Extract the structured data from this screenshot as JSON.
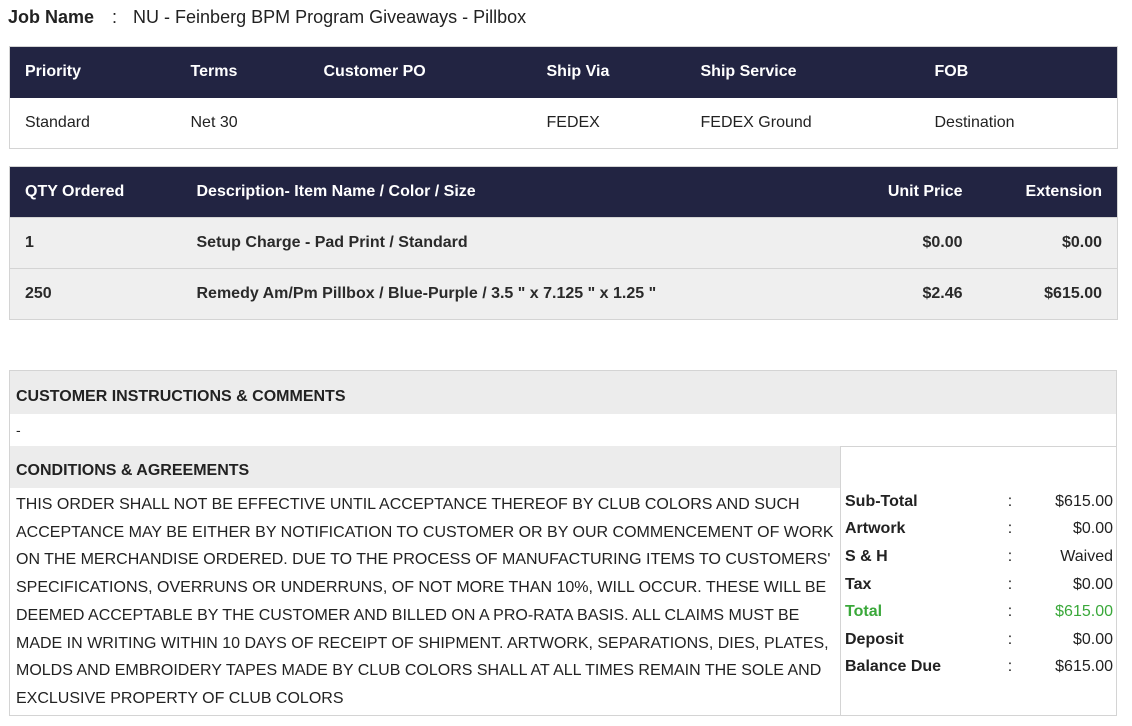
{
  "job": {
    "label": "Job Name",
    "colon": ":",
    "value": "NU - Feinberg BPM Program Giveaways - Pillbox"
  },
  "order_info": {
    "headers": [
      "Priority",
      "Terms",
      "Customer PO",
      "Ship Via",
      "Ship Service",
      "FOB"
    ],
    "row": [
      "Standard",
      "Net 30",
      "",
      "FEDEX",
      "FEDEX Ground",
      "Destination"
    ]
  },
  "items": {
    "headers": [
      "QTY Ordered",
      "Description- Item Name / Color / Size",
      "Unit Price",
      "Extension"
    ],
    "rows": [
      [
        "1",
        "Setup Charge - Pad Print / Standard",
        "$0.00",
        "$0.00"
      ],
      [
        "250",
        "Remedy Am/Pm Pillbox / Blue-Purple / 3.5 \" x 7.125 \" x 1.25 \"",
        "$2.46",
        "$615.00"
      ]
    ]
  },
  "instructions": {
    "title": "CUSTOMER INSTRUCTIONS & COMMENTS",
    "text": "-"
  },
  "conditions": {
    "title": "CONDITIONS & AGREEMENTS",
    "text": "THIS ORDER SHALL NOT BE EFFECTIVE UNTIL ACCEPTANCE THEREOF BY CLUB COLORS AND SUCH ACCEPTANCE MAY BE EITHER BY NOTIFICATION TO CUSTOMER OR BY OUR COMMENCEMENT OF WORK ON THE MERCHANDISE ORDERED. DUE TO THE PROCESS OF MANUFACTURING ITEMS TO CUSTOMERS' SPECIFICATIONS, OVERRUNS OR UNDERRUNS, OF NOT MORE THAN 10%, WILL OCCUR. THESE WILL BE DEEMED ACCEPTABLE BY THE CUSTOMER AND BILLED ON A PRO-RATA BASIS. ALL CLAIMS MUST BE MADE IN WRITING WITHIN 10 DAYS OF RECEIPT OF SHIPMENT. ARTWORK, SEPARATIONS, DIES, PLATES, MOLDS AND EMBROIDERY TAPES MADE BY CLUB COLORS SHALL AT ALL TIMES REMAIN THE SOLE AND EXCLUSIVE PROPERTY OF CLUB COLORS"
  },
  "totals": {
    "colon": ":",
    "rows": [
      {
        "label": "Sub-Total",
        "value": "$615.00"
      },
      {
        "label": "Artwork",
        "value": "$0.00"
      },
      {
        "label": "S & H",
        "value": "Waived"
      },
      {
        "label": "Tax",
        "value": "$0.00"
      },
      {
        "label": "Total",
        "value": "$615.00"
      },
      {
        "label": "Deposit",
        "value": "$0.00"
      },
      {
        "label": "Balance Due",
        "value": "$615.00"
      }
    ]
  },
  "colors": {
    "header_bg": "#222442",
    "total_green": "#3aa83a",
    "section_bg": "#ececec"
  }
}
